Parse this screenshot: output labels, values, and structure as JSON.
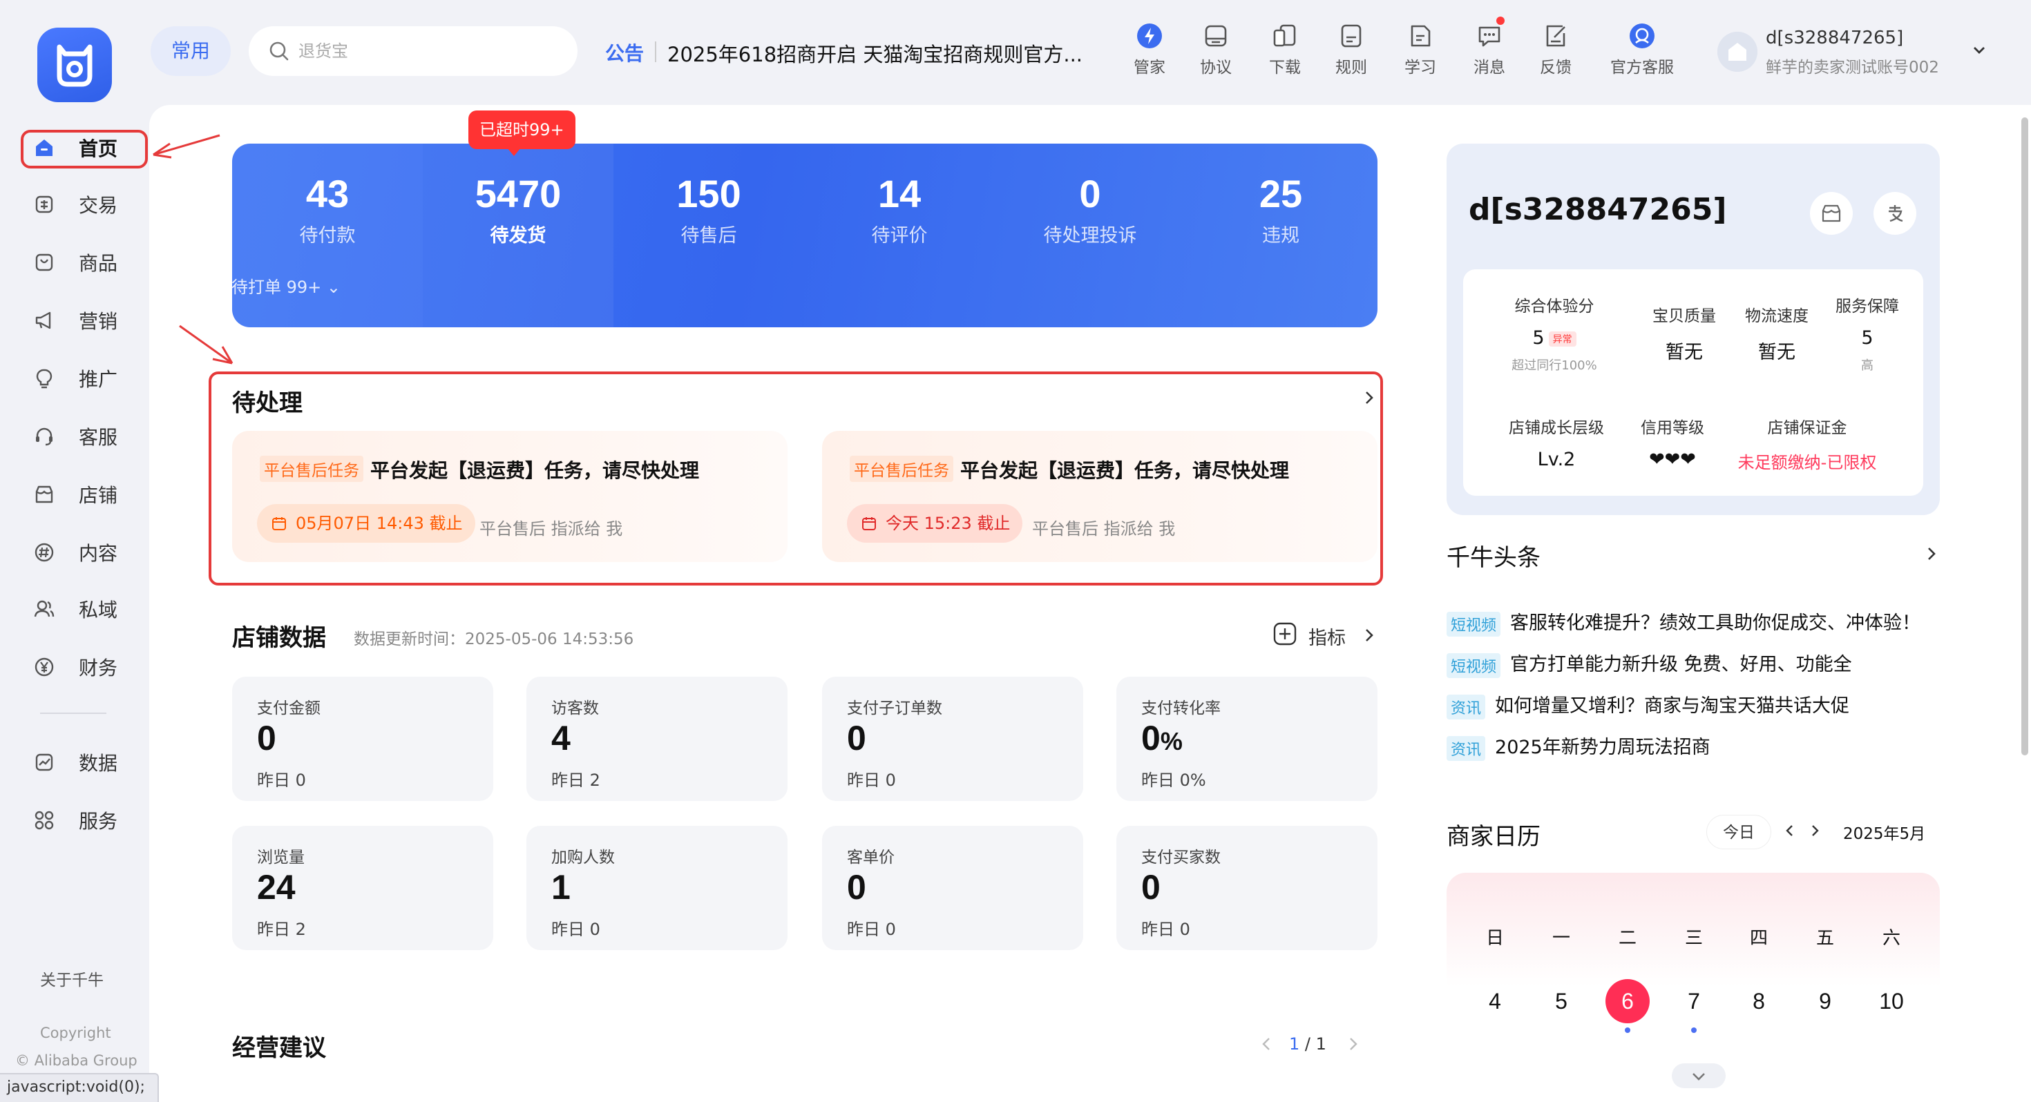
{
  "sidebar": {
    "items": [
      {
        "label": "首页",
        "icon": "home-icon"
      },
      {
        "label": "交易",
        "icon": "trade-icon"
      },
      {
        "label": "商品",
        "icon": "goods-icon"
      },
      {
        "label": "营销",
        "icon": "megaphone-icon"
      },
      {
        "label": "推广",
        "icon": "bulb-icon"
      },
      {
        "label": "客服",
        "icon": "headset-icon"
      },
      {
        "label": "店铺",
        "icon": "store-icon"
      },
      {
        "label": "内容",
        "icon": "hash-icon"
      },
      {
        "label": "私域",
        "icon": "users-icon"
      },
      {
        "label": "财务",
        "icon": "yen-icon"
      },
      {
        "label": "数据",
        "icon": "chart-icon"
      },
      {
        "label": "服务",
        "icon": "grid-icon"
      }
    ],
    "about": "关于千牛",
    "copyright": "Copyright",
    "company": "© Alibaba Group"
  },
  "statusbar": "javascript:void(0);",
  "topbar": {
    "frequent": "常用",
    "search_placeholder": "退货宝",
    "notice_label": "公告",
    "notice_text": "2025年618招商开启 天猫淘宝招商规则官方...",
    "icons": [
      {
        "label": "管家",
        "icon": "butler-icon"
      },
      {
        "label": "协议",
        "icon": "agreement-icon"
      },
      {
        "label": "下载",
        "icon": "download-icon"
      },
      {
        "label": "规则",
        "icon": "rules-icon"
      },
      {
        "label": "学习",
        "icon": "learn-icon"
      },
      {
        "label": "消息",
        "icon": "message-icon"
      },
      {
        "label": "反馈",
        "icon": "feedback-icon"
      },
      {
        "label": "官方客服",
        "icon": "support-icon"
      }
    ],
    "account_name": "d[s328847265]",
    "account_sub": "鲜芋的卖家测试账号002"
  },
  "stats": {
    "items": [
      {
        "value": "43",
        "label": "待付款"
      },
      {
        "value": "5470",
        "label": "待发货"
      },
      {
        "value": "150",
        "label": "待售后"
      },
      {
        "value": "14",
        "label": "待评价"
      },
      {
        "value": "0",
        "label": "待处理投诉"
      },
      {
        "value": "25",
        "label": "违规"
      }
    ],
    "overdue_badge": "已超时99+",
    "sub_label": "待打单 99+"
  },
  "pending": {
    "title": "待处理",
    "tasks": [
      {
        "badge": "平台售后任务",
        "title": "平台发起【退运费】任务，请尽快处理",
        "deadline": "05月07日 14:43 截止",
        "meta": "平台售后 指派给 我"
      },
      {
        "badge": "平台售后任务",
        "title": "平台发起【退运费】任务，请尽快处理",
        "deadline": "今天 15:23 截止",
        "meta": "平台售后 指派给 我"
      }
    ]
  },
  "store": {
    "title": "店铺数据",
    "updated": "数据更新时间：2025-05-06 14:53:56",
    "indicator": "指标",
    "metrics": [
      {
        "label": "支付金额",
        "value": "0",
        "unit": "",
        "yesterday": "昨日 0"
      },
      {
        "label": "访客数",
        "value": "4",
        "unit": "",
        "yesterday": "昨日 2"
      },
      {
        "label": "支付子订单数",
        "value": "0",
        "unit": "",
        "yesterday": "昨日 0"
      },
      {
        "label": "支付转化率",
        "value": "0",
        "unit": "%",
        "yesterday": "昨日 0%"
      },
      {
        "label": "浏览量",
        "value": "24",
        "unit": "",
        "yesterday": "昨日 2"
      },
      {
        "label": "加购人数",
        "value": "1",
        "unit": "",
        "yesterday": "昨日 0"
      },
      {
        "label": "客单价",
        "value": "0",
        "unit": "",
        "yesterday": "昨日 0"
      },
      {
        "label": "支付买家数",
        "value": "0",
        "unit": "",
        "yesterday": "昨日 0"
      }
    ]
  },
  "advice": {
    "title": "经营建议",
    "page_current": "1",
    "page_rest": " / 1"
  },
  "profile": {
    "shop_name": "d[s328847265]",
    "scores": {
      "overall_label": "综合体验分",
      "overall_value": "5",
      "overall_flag": "异常",
      "overall_sub": "超过同行100%",
      "quality_label": "宝贝质量",
      "quality_value": "暂无",
      "logistics_label": "物流速度",
      "logistics_value": "暂无",
      "service_label": "服务保障",
      "service_value": "5",
      "service_sub": "高",
      "growth_label": "店铺成长层级",
      "growth_value": "Lv.2",
      "credit_label": "信用等级",
      "credit_value": "❤❤❤",
      "deposit_label": "店铺保证金",
      "deposit_value": "未足额缴纳-已限权"
    }
  },
  "headlines": {
    "title": "千牛头条",
    "items": [
      {
        "tag": "短视频",
        "text": "客服转化难提升？绩效工具助你促成交、冲体验！"
      },
      {
        "tag": "短视频",
        "text": "官方打单能力新升级 免费、好用、功能全"
      },
      {
        "tag": "资讯",
        "text": "如何增量又增利？商家与淘宝天猫共话大促"
      },
      {
        "tag": "资讯",
        "text": "2025年新势力周玩法招商"
      }
    ]
  },
  "calendar": {
    "title": "商家日历",
    "today": "今日",
    "month": "2025年5月",
    "weekdays": [
      "日",
      "一",
      "二",
      "三",
      "四",
      "五",
      "六"
    ],
    "days": [
      "4",
      "5",
      "6",
      "7",
      "8",
      "9",
      "10"
    ],
    "selected_day": "6"
  },
  "colors": {
    "accent": "#3b6cf0",
    "alert": "#e53a3a",
    "selected_day": "#ff2e55",
    "deposit_warning": "#ff3a5c"
  }
}
